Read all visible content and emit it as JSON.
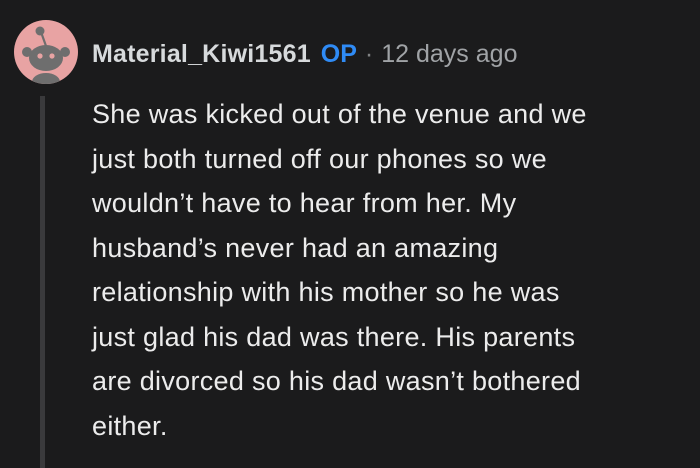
{
  "comment": {
    "avatar_icon": "reddit-snoo-avatar-icon",
    "author": "Material_Kiwi1561",
    "op_badge": "OP",
    "separator": "·",
    "timestamp": "12 days ago",
    "body": "She was kicked out of the venue and we\njust both turned off our phones so we\nwouldn’t have to hear from her. My\nhusband’s never had an amazing\nrelationship with his mother so he was\njust glad his dad was there. His parents\nare divorced so his dad wasn’t bothered\neither."
  },
  "colors": {
    "background": "#1b1b1c",
    "avatar_bg": "#e8a3a3",
    "op_badge": "#2f8bf5",
    "text": "#ececec",
    "muted": "#a0a3a6"
  }
}
